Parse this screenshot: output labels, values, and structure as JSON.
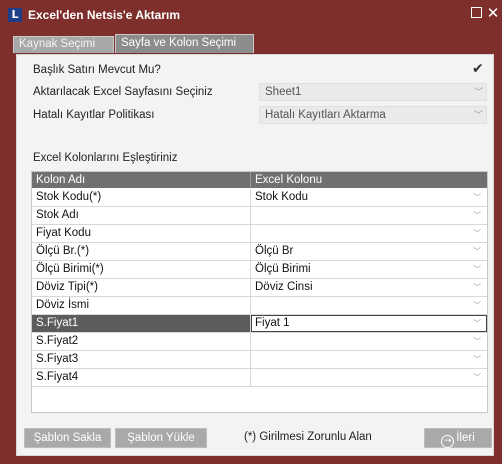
{
  "window": {
    "title": "Excel'den Netsis'e Aktarım",
    "logo_letter": "L",
    "maximize_icon": "maximize-icon",
    "close_symbol": "✕"
  },
  "tabs": [
    {
      "label": "Kaynak Seçimi",
      "active": false
    },
    {
      "label": "Sayfa ve Kolon Seçimi",
      "active": true
    }
  ],
  "form": {
    "header_row_label": "Başlık Satırı Mevcut Mu?",
    "header_row_checked": true,
    "sheet_label": "Aktarılacak Excel Sayfasını Seçiniz",
    "sheet_value": "Sheet1",
    "error_policy_label": "Hatalı Kayıtlar Politikası",
    "error_policy_value": "Hatalı Kayıtları Aktarma",
    "mapping_label": "Excel Kolonlarını Eşleştiriniz"
  },
  "grid": {
    "headers": [
      "Kolon Adı",
      "Excel Kolonu"
    ],
    "rows": [
      {
        "name": "Stok Kodu(*)",
        "value": "Stok Kodu"
      },
      {
        "name": "Stok Adı",
        "value": ""
      },
      {
        "name": "Fiyat Kodu",
        "value": ""
      },
      {
        "name": "Ölçü Br.(*)",
        "value": "Ölçü Br"
      },
      {
        "name": "Ölçü Birimi(*)",
        "value": "Ölçü Birimi"
      },
      {
        "name": "Döviz Tipi(*)",
        "value": "Döviz Cinsi"
      },
      {
        "name": "Döviz İsmi",
        "value": ""
      },
      {
        "name": "S.Fiyat1",
        "value": "Fiyat 1",
        "selected": true
      },
      {
        "name": "S.Fiyat2",
        "value": ""
      },
      {
        "name": "S.Fiyat3",
        "value": ""
      },
      {
        "name": "S.Fiyat4",
        "value": ""
      }
    ]
  },
  "footer": {
    "save_template": "Şablon Sakla",
    "load_template": "Şablon Yükle",
    "required_note": "(*) Girilmesi Zorunlu Alan",
    "next": "İleri"
  }
}
